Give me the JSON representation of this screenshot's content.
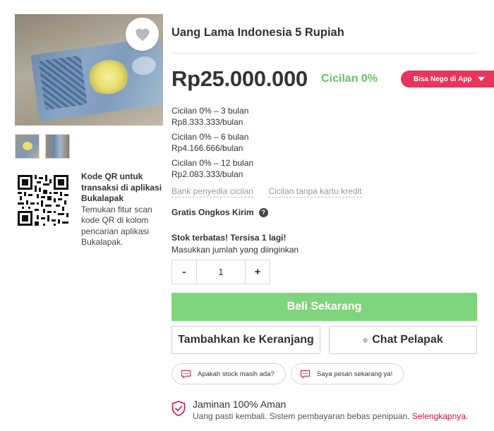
{
  "product": {
    "title": "Uang Lama Indonesia 5 Rupiah",
    "price": "Rp25.000.000",
    "cicilan_badge": "Cicilan 0%",
    "nego_label": "Bisa Nego di App"
  },
  "installments": [
    {
      "plan": "Cicilan 0% – 3 bulan",
      "amount": "Rp8.333.333/bulan"
    },
    {
      "plan": "Cicilan 0% – 6 bulan",
      "amount": "Rp4.166.666/bulan"
    },
    {
      "plan": "Cicilan 0% – 12 bulan",
      "amount": "Rp2.083.333/bulan"
    }
  ],
  "links": {
    "bank": "Bank penyedia cicilan",
    "no_card": "Cicilan tanpa kartu kredit"
  },
  "shipping": {
    "label": "Gratis Ongkos Kirim",
    "help_icon": "?"
  },
  "stock": {
    "warning": "Stok terbatas! Tersisa 1 lagi!",
    "prompt": "Masukkan jumlah yang diinginkan",
    "minus": "-",
    "quantity": "1",
    "plus": "+"
  },
  "actions": {
    "buy": "Beli Sekarang",
    "cart": "Tambahkan ke Keranjang",
    "chat": "Chat Pelapak"
  },
  "quick_chats": [
    "Apakah stock masih ada?",
    "Saya pesan sekarang ya!"
  ],
  "guarantee": {
    "title": "Jaminan 100% Aman",
    "desc": "Uang pasti kembali. Sistem pembayaran bebas penipuan.",
    "link": "Selengkapnya."
  },
  "qr": {
    "title": "Kode QR untuk transaksi di aplikasi Bukalapak",
    "desc": "Temukan fitur scan kode QR di kolom pencarian aplikasi Bukalapak."
  },
  "colors": {
    "accent_green": "#7fd57c",
    "cicilan_green": "#6abf69",
    "nego_pink": "#e8355c",
    "link_red": "#d71149"
  },
  "icons": {
    "favorite": "heart-icon",
    "help": "help-circle-icon",
    "chat_bubble": "chat-bubble-icon",
    "guarantee": "shield-check-icon",
    "nego_caret": "caret-down-icon"
  }
}
